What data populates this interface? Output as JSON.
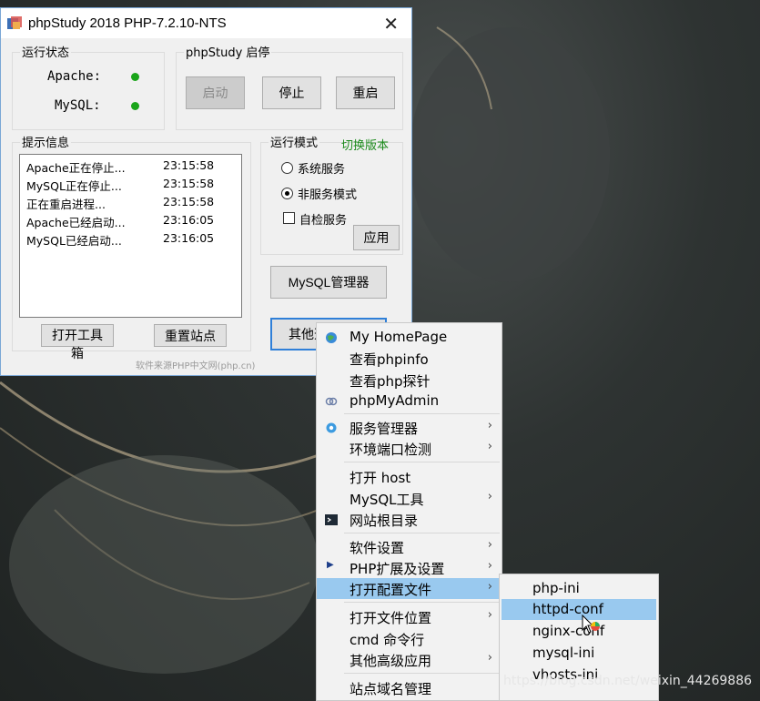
{
  "window": {
    "title": "phpStudy 2018   PHP-7.2.10-NTS",
    "close": "✕",
    "status_group": {
      "title": "运行状态",
      "apache_label": "Apache:",
      "mysql_label": "MySQL:"
    },
    "control_group": {
      "title": "phpStudy 启停",
      "start": "启动",
      "stop": "停止",
      "restart": "重启"
    },
    "info_group": {
      "title": "提示信息",
      "log": [
        {
          "msg": "Apache正在停止...",
          "time": "23:15:58"
        },
        {
          "msg": "MySQL正在停止...",
          "time": "23:15:58"
        },
        {
          "msg": "正在重启进程...",
          "time": "23:15:58"
        },
        {
          "msg": "Apache已经启动...",
          "time": "23:16:05"
        },
        {
          "msg": "MySQL已经启动...",
          "time": "23:16:05"
        }
      ],
      "toolbox_button": "打开工具箱",
      "reset_site_button": "重置站点"
    },
    "mode_group": {
      "title": "运行模式",
      "switch_version": "切换版本",
      "system_service": "系统服务",
      "non_service": "非服务模式",
      "self_check": "自检服务",
      "apply": "应用"
    },
    "mysql_manager": "MySQL管理器",
    "other_button": "其他选项",
    "footer": "软件来源PHP中文网(php.cn)"
  },
  "menu": {
    "items": [
      {
        "label": "My HomePage",
        "icon": "globe-icon"
      },
      {
        "label": "查看phpinfo"
      },
      {
        "label": "查看php探针"
      },
      {
        "label": "phpMyAdmin",
        "icon": "link-icon"
      },
      {
        "label": "服务管理器",
        "icon": "gear-icon",
        "sub": true
      },
      {
        "label": "环境端口检测",
        "sub": true
      },
      {
        "label": "打开 host"
      },
      {
        "label": "MySQL工具",
        "sub": true
      },
      {
        "label": "网站根目录",
        "icon": "terminal-icon"
      },
      {
        "label": "软件设置",
        "sub": true
      },
      {
        "label": "PHP扩展及设置",
        "sub": true,
        "marker": "▶"
      },
      {
        "label": "打开配置文件",
        "sub": true,
        "highlight": true
      },
      {
        "label": "打开文件位置",
        "sub": true
      },
      {
        "label": "cmd 命令行"
      },
      {
        "label": "其他高级应用",
        "sub": true
      },
      {
        "label": "站点域名管理"
      }
    ]
  },
  "submenu": {
    "items": [
      {
        "label": "php-ini"
      },
      {
        "label": "httpd-conf",
        "highlight": true
      },
      {
        "label": "nginx-conf"
      },
      {
        "label": "mysql-ini"
      },
      {
        "label": "vhosts-ini"
      }
    ]
  },
  "watermark": "https://blog.csdn.net/weixin_44269886",
  "colors": {
    "accent_green": "#1aa51a",
    "highlight": "#99c9ef"
  }
}
